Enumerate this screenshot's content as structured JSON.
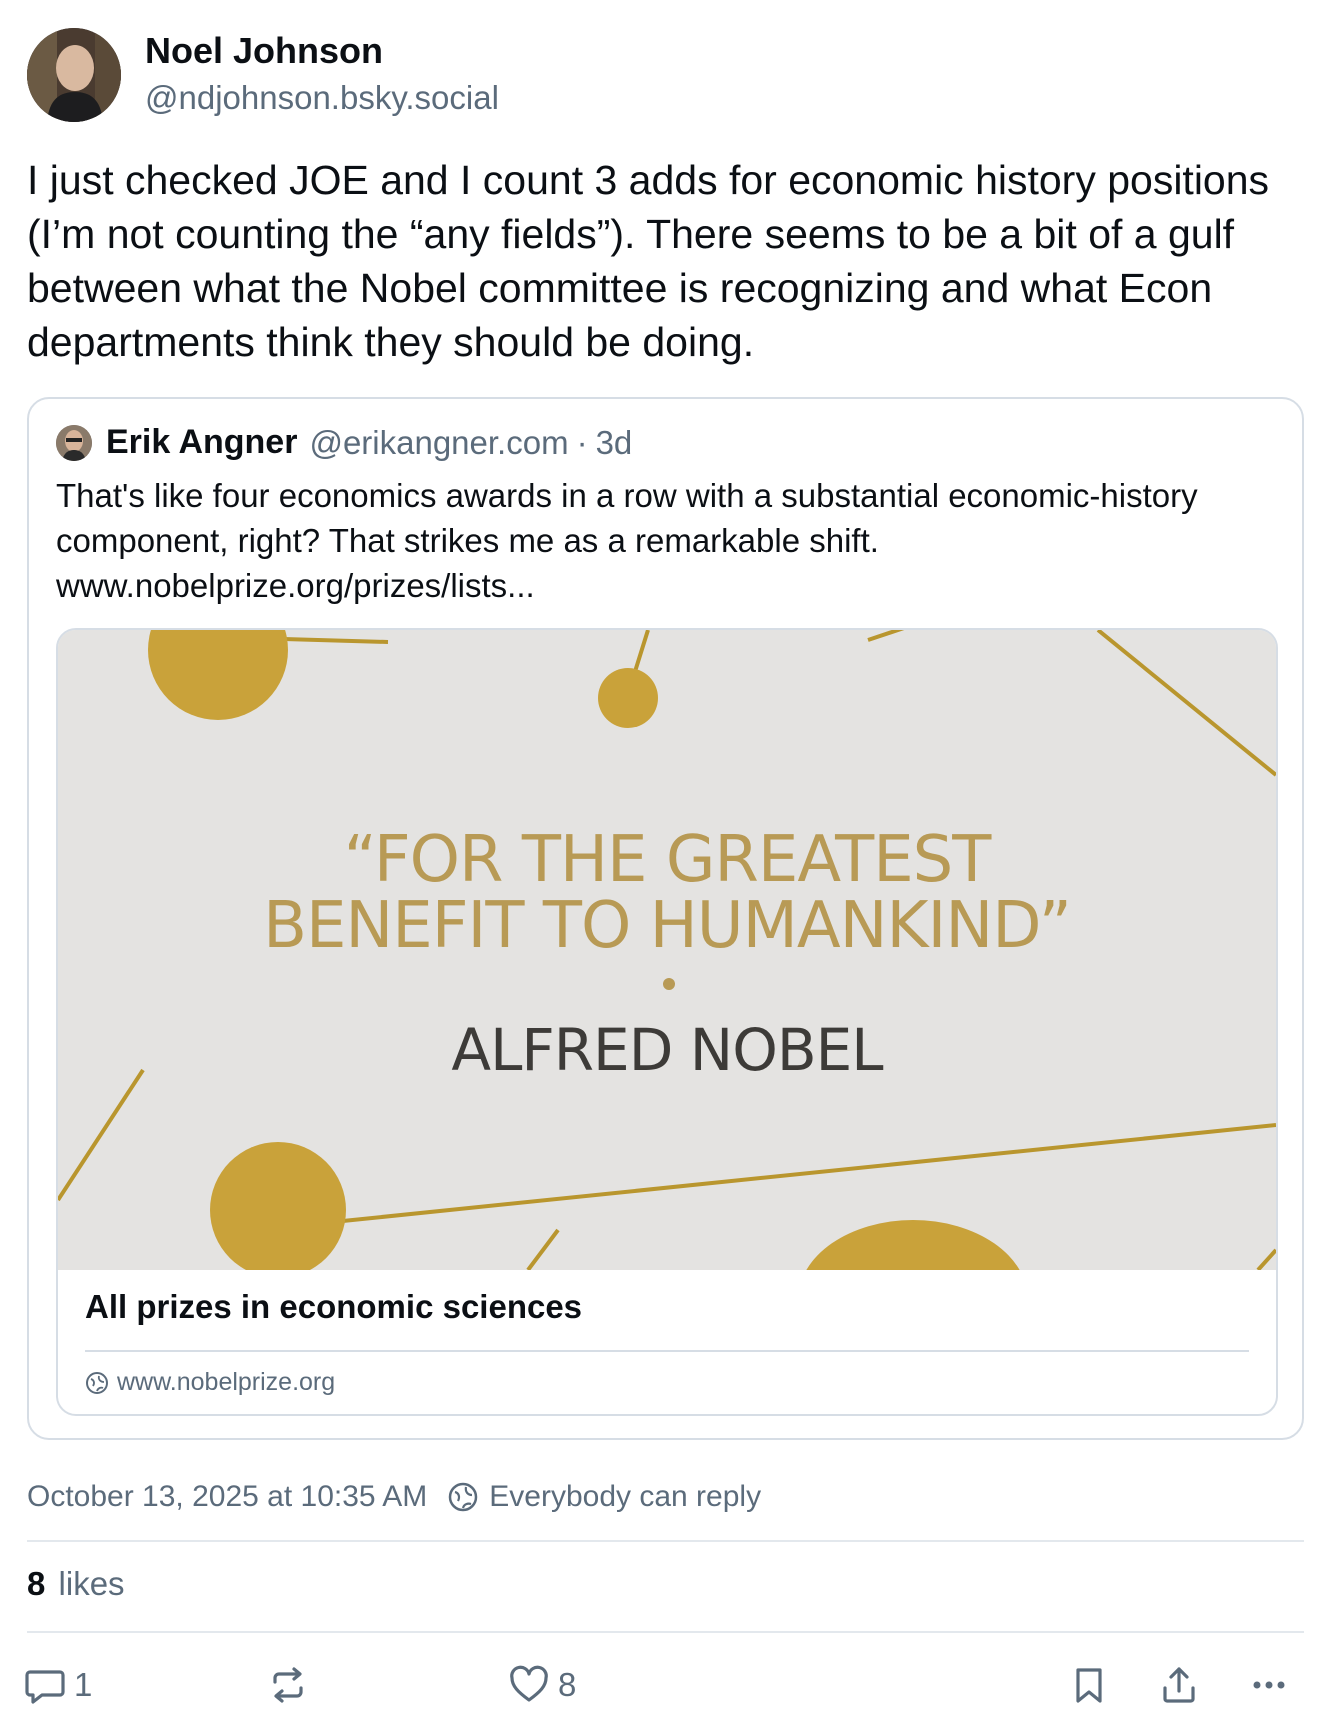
{
  "post": {
    "author": {
      "display_name": "Noel Johnson",
      "handle": "@ndjohnson.bsky.social"
    },
    "text": "I just checked JOE and I count 3 adds for economic history positions (I’m not counting the “any fields”). There seems to be a bit of a gulf between what the Nobel committee is recognizing and what Econ departments think they should be doing.",
    "timestamp": "October 13, 2025 at 10:35 AM",
    "reply_setting": "Everybody can reply",
    "likes": {
      "count": "8",
      "label": "likes"
    },
    "actions": {
      "reply_count": "1",
      "like_count": "8"
    }
  },
  "quote": {
    "author": {
      "display_name": "Erik Angner",
      "handle": "@erikangner.com"
    },
    "separator": "·",
    "time_ago": "3d",
    "text": "That's like four economics awards in a row with a substantial economic-history component, right? That strikes me as a remarkable shift. www.nobelprize.org/prizes/lists...",
    "link_card": {
      "image_quote_line1": "“FOR THE GREATEST",
      "image_quote_line2": "BENEFIT TO HUMANKIND”",
      "image_author": "ALFRED NOBEL",
      "title": "All prizes in economic sciences",
      "domain": "www.nobelprize.org"
    }
  },
  "colors": {
    "text_primary": "#0b0f14",
    "text_secondary": "#5b6b7b",
    "border": "#d6dde5",
    "gold": "#c9a23a",
    "image_bg": "#e4e3e1"
  }
}
